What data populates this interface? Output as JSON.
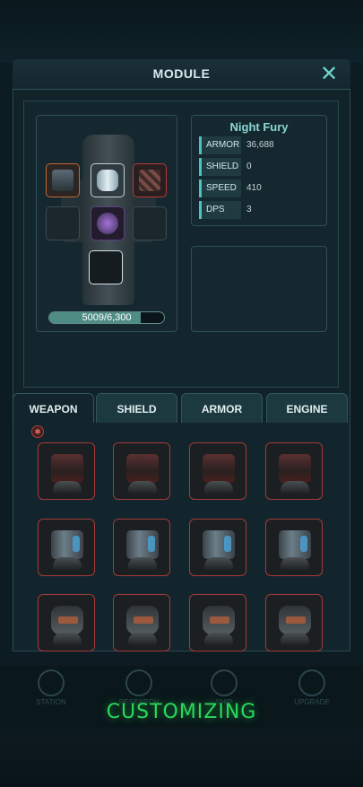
{
  "header": {
    "title": "MODULE",
    "close_symbol": "✕"
  },
  "ship": {
    "hp_text": "5009/6,300",
    "hp_fraction": 0.795,
    "slots": [
      {
        "kind": "weapon",
        "icon": "turret-icon"
      },
      {
        "kind": "shield",
        "icon": "shield-module-icon"
      },
      {
        "kind": "armor",
        "icon": "armor-module-icon"
      },
      {
        "kind": "empty"
      },
      {
        "kind": "engine",
        "icon": "engine-module-icon"
      },
      {
        "kind": "empty"
      },
      {
        "kind": "empty-white"
      }
    ]
  },
  "stats": {
    "name": "Night Fury",
    "rows": [
      {
        "label": "ARMOR",
        "value": "36,688"
      },
      {
        "label": "SHIELD",
        "value": "0"
      },
      {
        "label": "SPEED",
        "value": "410"
      },
      {
        "label": "DPS",
        "value": "3"
      }
    ]
  },
  "tabs": [
    {
      "label": "WEAPON",
      "active": true
    },
    {
      "label": "SHIELD",
      "active": false
    },
    {
      "label": "ARMOR",
      "active": false
    },
    {
      "label": "ENGINE",
      "active": false
    }
  ],
  "filter_badge_icon": "weapon-filter-icon",
  "inventory": [
    "t0",
    "t0",
    "t0",
    "t0",
    "t1",
    "t1",
    "t1",
    "t1",
    "t2",
    "t2",
    "t2",
    "t2"
  ],
  "bottom_nav": [
    "STATION",
    "RESEARCH",
    "SHIP",
    "UPGRADE"
  ],
  "status_banner": "CUSTOMIZING",
  "colors": {
    "accent": "#4ec3bd",
    "rarity_border": "#a33a3a",
    "banner": "#2bd85a"
  }
}
